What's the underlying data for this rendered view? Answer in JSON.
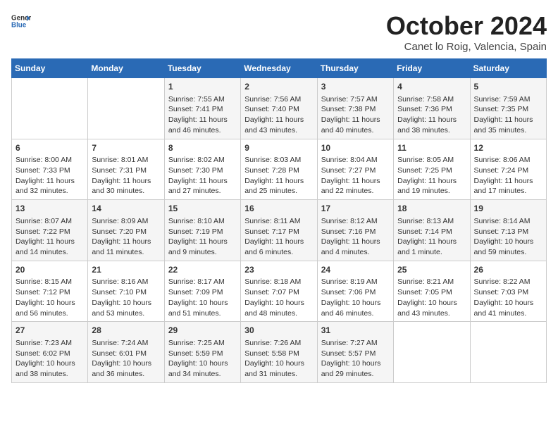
{
  "header": {
    "logo_general": "General",
    "logo_blue": "Blue",
    "month_title": "October 2024",
    "location": "Canet lo Roig, Valencia, Spain"
  },
  "days_of_week": [
    "Sunday",
    "Monday",
    "Tuesday",
    "Wednesday",
    "Thursday",
    "Friday",
    "Saturday"
  ],
  "weeks": [
    [
      {
        "day": "",
        "info": ""
      },
      {
        "day": "",
        "info": ""
      },
      {
        "day": "1",
        "info": "Sunrise: 7:55 AM\nSunset: 7:41 PM\nDaylight: 11 hours and 46 minutes."
      },
      {
        "day": "2",
        "info": "Sunrise: 7:56 AM\nSunset: 7:40 PM\nDaylight: 11 hours and 43 minutes."
      },
      {
        "day": "3",
        "info": "Sunrise: 7:57 AM\nSunset: 7:38 PM\nDaylight: 11 hours and 40 minutes."
      },
      {
        "day": "4",
        "info": "Sunrise: 7:58 AM\nSunset: 7:36 PM\nDaylight: 11 hours and 38 minutes."
      },
      {
        "day": "5",
        "info": "Sunrise: 7:59 AM\nSunset: 7:35 PM\nDaylight: 11 hours and 35 minutes."
      }
    ],
    [
      {
        "day": "6",
        "info": "Sunrise: 8:00 AM\nSunset: 7:33 PM\nDaylight: 11 hours and 32 minutes."
      },
      {
        "day": "7",
        "info": "Sunrise: 8:01 AM\nSunset: 7:31 PM\nDaylight: 11 hours and 30 minutes."
      },
      {
        "day": "8",
        "info": "Sunrise: 8:02 AM\nSunset: 7:30 PM\nDaylight: 11 hours and 27 minutes."
      },
      {
        "day": "9",
        "info": "Sunrise: 8:03 AM\nSunset: 7:28 PM\nDaylight: 11 hours and 25 minutes."
      },
      {
        "day": "10",
        "info": "Sunrise: 8:04 AM\nSunset: 7:27 PM\nDaylight: 11 hours and 22 minutes."
      },
      {
        "day": "11",
        "info": "Sunrise: 8:05 AM\nSunset: 7:25 PM\nDaylight: 11 hours and 19 minutes."
      },
      {
        "day": "12",
        "info": "Sunrise: 8:06 AM\nSunset: 7:24 PM\nDaylight: 11 hours and 17 minutes."
      }
    ],
    [
      {
        "day": "13",
        "info": "Sunrise: 8:07 AM\nSunset: 7:22 PM\nDaylight: 11 hours and 14 minutes."
      },
      {
        "day": "14",
        "info": "Sunrise: 8:09 AM\nSunset: 7:20 PM\nDaylight: 11 hours and 11 minutes."
      },
      {
        "day": "15",
        "info": "Sunrise: 8:10 AM\nSunset: 7:19 PM\nDaylight: 11 hours and 9 minutes."
      },
      {
        "day": "16",
        "info": "Sunrise: 8:11 AM\nSunset: 7:17 PM\nDaylight: 11 hours and 6 minutes."
      },
      {
        "day": "17",
        "info": "Sunrise: 8:12 AM\nSunset: 7:16 PM\nDaylight: 11 hours and 4 minutes."
      },
      {
        "day": "18",
        "info": "Sunrise: 8:13 AM\nSunset: 7:14 PM\nDaylight: 11 hours and 1 minute."
      },
      {
        "day": "19",
        "info": "Sunrise: 8:14 AM\nSunset: 7:13 PM\nDaylight: 10 hours and 59 minutes."
      }
    ],
    [
      {
        "day": "20",
        "info": "Sunrise: 8:15 AM\nSunset: 7:12 PM\nDaylight: 10 hours and 56 minutes."
      },
      {
        "day": "21",
        "info": "Sunrise: 8:16 AM\nSunset: 7:10 PM\nDaylight: 10 hours and 53 minutes."
      },
      {
        "day": "22",
        "info": "Sunrise: 8:17 AM\nSunset: 7:09 PM\nDaylight: 10 hours and 51 minutes."
      },
      {
        "day": "23",
        "info": "Sunrise: 8:18 AM\nSunset: 7:07 PM\nDaylight: 10 hours and 48 minutes."
      },
      {
        "day": "24",
        "info": "Sunrise: 8:19 AM\nSunset: 7:06 PM\nDaylight: 10 hours and 46 minutes."
      },
      {
        "day": "25",
        "info": "Sunrise: 8:21 AM\nSunset: 7:05 PM\nDaylight: 10 hours and 43 minutes."
      },
      {
        "day": "26",
        "info": "Sunrise: 8:22 AM\nSunset: 7:03 PM\nDaylight: 10 hours and 41 minutes."
      }
    ],
    [
      {
        "day": "27",
        "info": "Sunrise: 7:23 AM\nSunset: 6:02 PM\nDaylight: 10 hours and 38 minutes."
      },
      {
        "day": "28",
        "info": "Sunrise: 7:24 AM\nSunset: 6:01 PM\nDaylight: 10 hours and 36 minutes."
      },
      {
        "day": "29",
        "info": "Sunrise: 7:25 AM\nSunset: 5:59 PM\nDaylight: 10 hours and 34 minutes."
      },
      {
        "day": "30",
        "info": "Sunrise: 7:26 AM\nSunset: 5:58 PM\nDaylight: 10 hours and 31 minutes."
      },
      {
        "day": "31",
        "info": "Sunrise: 7:27 AM\nSunset: 5:57 PM\nDaylight: 10 hours and 29 minutes."
      },
      {
        "day": "",
        "info": ""
      },
      {
        "day": "",
        "info": ""
      }
    ]
  ]
}
